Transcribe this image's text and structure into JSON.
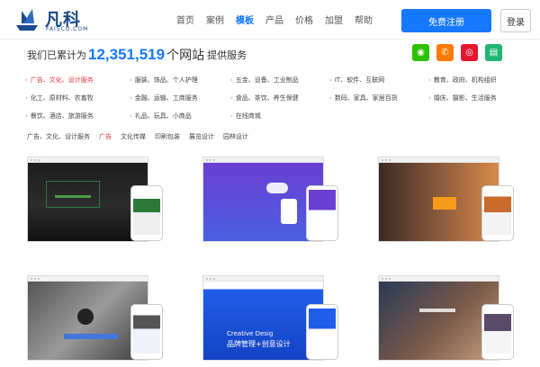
{
  "header": {
    "logo_name": "凡科",
    "logo_sub": "FAISCO.COM",
    "nav": [
      "首页",
      "案例",
      "模板",
      "产品",
      "价格",
      "加盟",
      "帮助"
    ],
    "nav_active": "模板",
    "register_label": "免费注册",
    "login_label": "登录"
  },
  "stats": {
    "prefix": "我们已累计为",
    "number": "12,351,519",
    "unit": "个网站",
    "suffix": "提供服务"
  },
  "social": [
    {
      "icon": "wechat-icon",
      "color": "#2dc100",
      "glyph": "◉"
    },
    {
      "icon": "phone-icon",
      "color": "#ff7a00",
      "glyph": "✆"
    },
    {
      "icon": "weibo-icon",
      "color": "#e6162d",
      "glyph": "◎"
    },
    {
      "icon": "calendar-icon",
      "color": "#20b573",
      "glyph": "▤"
    }
  ],
  "categories": [
    [
      "广告、文化、设计服务",
      "服装、饰品、个人护理",
      "五金、设备、工业制品",
      "IT、软件、互联网",
      "教育、政府、机构组织"
    ],
    [
      "化工、原材料、农畜牧",
      "金融、运输、工商服务",
      "食品、茶饮、养生保健",
      "数码、家具、家居百货",
      "婚庆、摄影、生活服务"
    ],
    [
      "餐饮、酒店、旅游服务",
      "礼品、玩具、小商品",
      "在线商城"
    ]
  ],
  "category_active": "广告、文化、设计服务",
  "filters": {
    "label": "广告、文化、设计服务",
    "items": [
      "广告",
      "文化传媒",
      "印刷包装",
      "展览设计",
      "园林设计"
    ],
    "active": "广告"
  },
  "cards": [
    {
      "text": "",
      "phone_text": ""
    },
    {
      "text": "",
      "phone_text": ""
    },
    {
      "text": "",
      "phone_text": ""
    },
    {
      "text": "",
      "phone_text": ""
    },
    {
      "text": "Creative Desig",
      "text2": "品牌管理+创意设计"
    },
    {
      "text": "",
      "phone_text": ""
    }
  ],
  "colors": {
    "accent": "#1677ff",
    "active_red": "#e4393c"
  }
}
